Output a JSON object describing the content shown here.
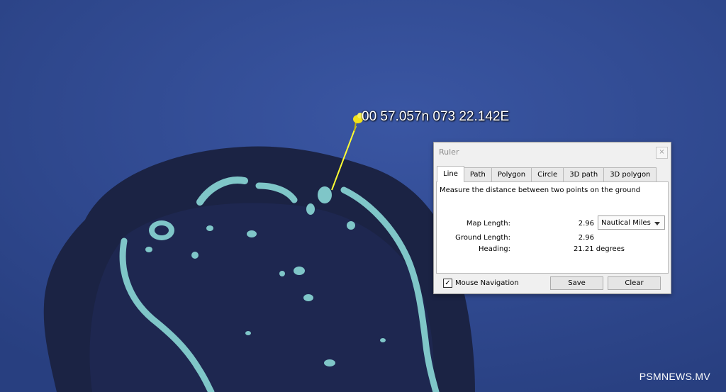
{
  "map": {
    "pin_label": "00 57.057n 073 22.142E",
    "watermark": "PSMNEWS.MV",
    "colors": {
      "ocean": "#2f4a8f",
      "atoll_shadow": "#1b2344",
      "reef": "#7fc6c8",
      "ruler_line": "#ffff33",
      "pin": "#f2e21b"
    },
    "icons": {
      "pin": "yellow-pushpin-icon"
    }
  },
  "ruler": {
    "title": "Ruler",
    "close_glyph": "×",
    "tabs": [
      {
        "label": "Line",
        "active": true
      },
      {
        "label": "Path"
      },
      {
        "label": "Polygon"
      },
      {
        "label": "Circle"
      },
      {
        "label": "3D path"
      },
      {
        "label": "3D polygon"
      }
    ],
    "description": "Measure the distance between two points on the ground",
    "map_length_label": "Map Length:",
    "map_length_value": "2.96",
    "unit": "Nautical Miles",
    "ground_length_label": "Ground Length:",
    "ground_length_value": "2.96",
    "heading_label": "Heading:",
    "heading_value": "21.21 degrees",
    "mouse_nav_label": "Mouse Navigation",
    "mouse_nav_checked": true,
    "save_label": "Save",
    "clear_label": "Clear"
  }
}
